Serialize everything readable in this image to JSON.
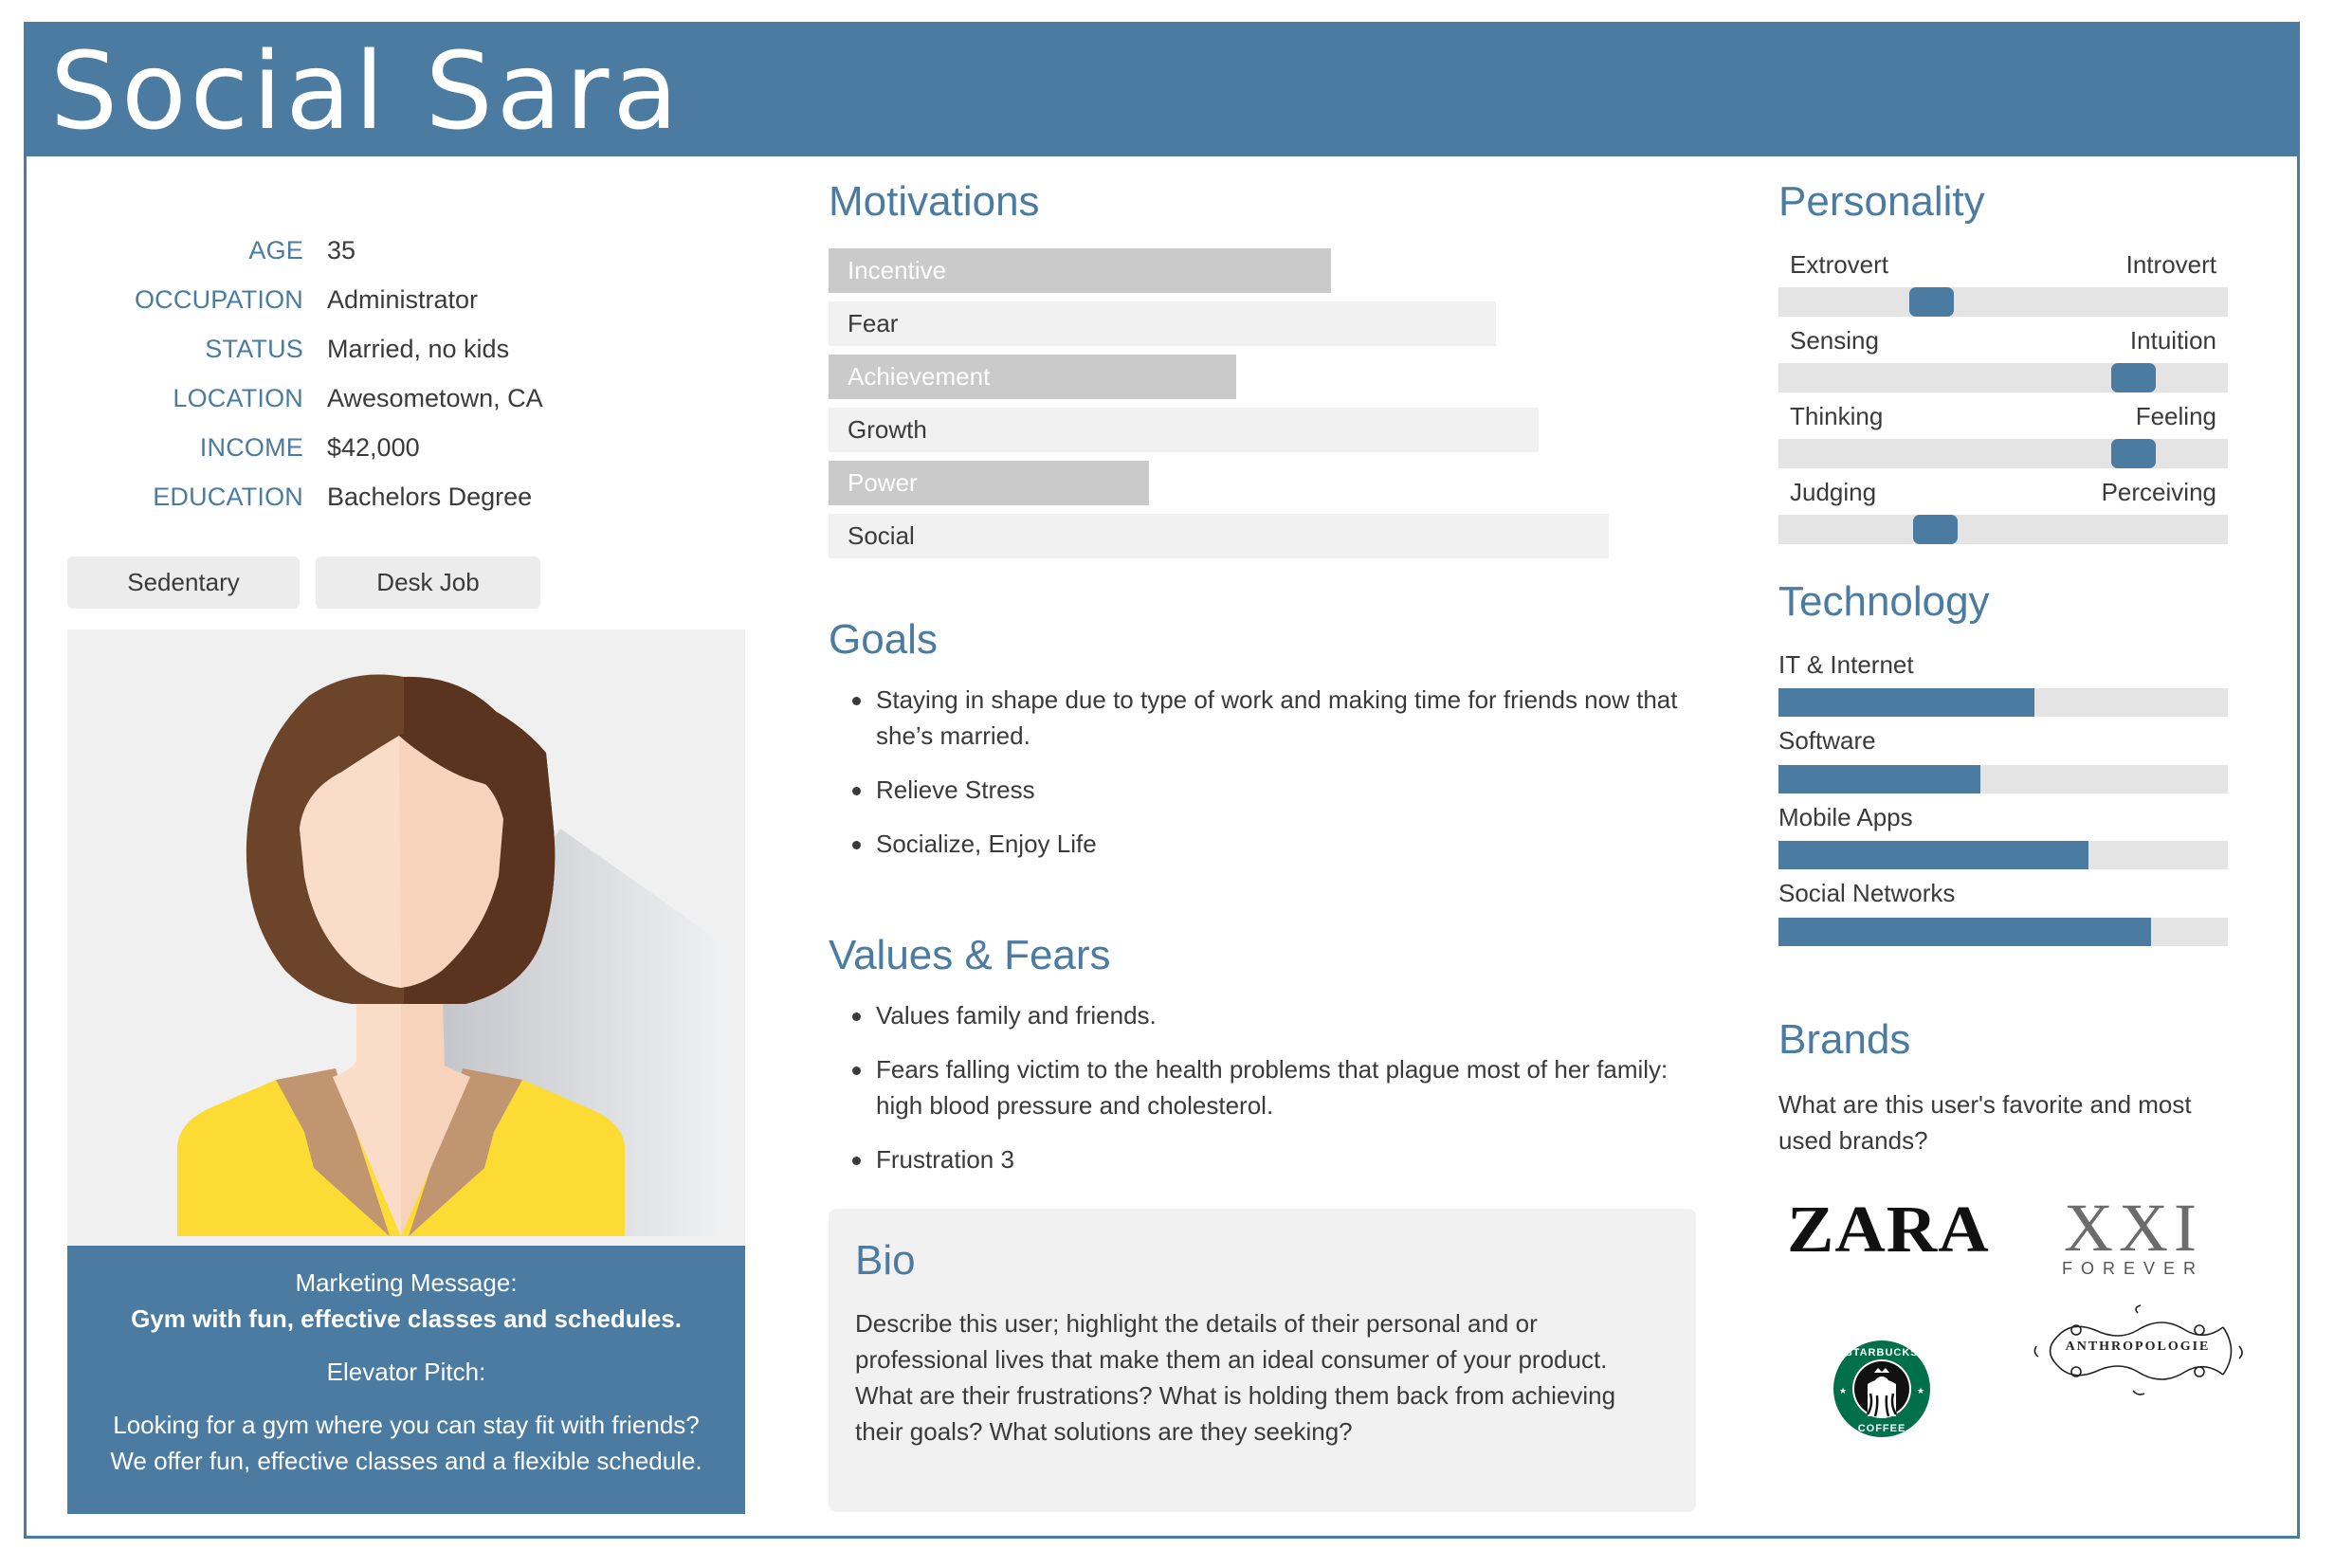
{
  "header": {
    "title": "Social Sara"
  },
  "profile": {
    "facts": [
      {
        "label": "AGE",
        "value": "35"
      },
      {
        "label": "OCCUPATION",
        "value": "Administrator"
      },
      {
        "label": "STATUS",
        "value": "Married, no kids"
      },
      {
        "label": "LOCATION",
        "value": "Awesometown, CA"
      },
      {
        "label": "INCOME",
        "value": "$42,000"
      },
      {
        "label": "EDUCATION",
        "value": "Bachelors Degree"
      }
    ],
    "tags": [
      "Sedentary",
      "Desk Job"
    ],
    "avatar_icon": "female-avatar-icon"
  },
  "pitch": {
    "marketing_label": "Marketing Message:",
    "marketing_text": "Gym with fun, effective classes and schedules.",
    "elevator_label": "Elevator Pitch:",
    "elevator_line1": "Looking for a gym where you can stay fit with friends?",
    "elevator_line2": "We offer fun, effective classes and a flexible schedule."
  },
  "motivations": {
    "heading": "Motivations",
    "items": [
      {
        "label": "Incentive",
        "value": 0.58,
        "style": "dark"
      },
      {
        "label": "Fear",
        "value": 0.77,
        "style": "light"
      },
      {
        "label": "Achievement",
        "value": 0.47,
        "style": "dark"
      },
      {
        "label": "Growth",
        "value": 0.82,
        "style": "light"
      },
      {
        "label": "Power",
        "value": 0.37,
        "style": "dark"
      },
      {
        "label": "Social",
        "value": 0.9,
        "style": "light"
      }
    ]
  },
  "goals": {
    "heading": "Goals",
    "items": [
      "Staying in shape due to type of work and making time for friends now that she’s married.",
      "Relieve Stress",
      "Socialize, Enjoy Life"
    ]
  },
  "values_fears": {
    "heading": "Values & Fears",
    "items": [
      "Values family and friends.",
      "Fears falling victim to the health problems that plague most of her family: high blood pressure and cholesterol.",
      "Frustration 3"
    ]
  },
  "bio": {
    "heading": "Bio",
    "text": "Describe this user; highlight the details of their personal and or professional lives that make them an ideal consumer of your product. What are their frustrations? What is holding them back from achieving their goals? What solutions are they seeking?"
  },
  "personality": {
    "heading": "Personality",
    "scales": [
      {
        "left": "Extrovert",
        "right": "Introvert",
        "value": 0.34
      },
      {
        "left": "Sensing",
        "right": "Intuition",
        "value": 0.79
      },
      {
        "left": "Thinking",
        "right": "Feeling",
        "value": 0.79
      },
      {
        "left": "Judging",
        "right": "Perceiving",
        "value": 0.35
      }
    ]
  },
  "technology": {
    "heading": "Technology",
    "items": [
      {
        "label": "IT & Internet",
        "value": 0.57
      },
      {
        "label": "Software",
        "value": 0.45
      },
      {
        "label": "Mobile Apps",
        "value": 0.69
      },
      {
        "label": "Social Networks",
        "value": 0.83
      }
    ]
  },
  "brands": {
    "heading": "Brands",
    "question": "What are this user's favorite and most used brands?",
    "logos": [
      {
        "name": "ZARA",
        "text": "ZARA"
      },
      {
        "name": "Forever 21",
        "text": "XXI",
        "subtext": "FOREVER"
      },
      {
        "name": "Starbucks Coffee",
        "text": "STARBUCKS COFFEE"
      },
      {
        "name": "Anthropologie",
        "text": "ANTHROPOLOGIE"
      }
    ]
  },
  "colors": {
    "accent": "#4b7ba0",
    "bar_dark": "#cacaca",
    "bar_light": "#f1f1f1",
    "track": "#e4e4e4",
    "text": "#3a3a3a"
  }
}
